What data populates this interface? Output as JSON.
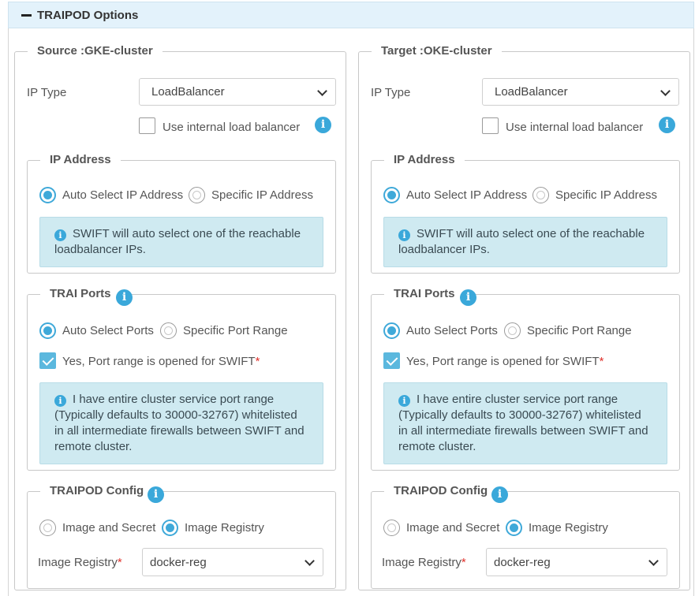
{
  "header": {
    "title": "TRAIPOD Options"
  },
  "panels": [
    {
      "legend": "Source :GKE-cluster",
      "ip_type_label": "IP Type",
      "ip_type_value": "LoadBalancer",
      "internal_lb_label": "Use internal load balancer",
      "ip_address": {
        "legend": "IP Address",
        "option_auto": "Auto Select IP Address",
        "option_specific": "Specific IP Address",
        "alert": "SWIFT will auto select one of the reachable loadbalancer IPs."
      },
      "trai_ports": {
        "legend": "TRAI Ports",
        "option_auto": "Auto Select Ports",
        "option_specific": "Specific Port Range",
        "checkbox_label": "Yes, Port range is opened for SWIFT",
        "required": "*",
        "alert": "I have entire cluster service port range (Typically defaults to 30000-32767) whitelisted in all intermediate firewalls between SWIFT and remote cluster."
      },
      "traipod_config": {
        "legend": "TRAIPOD Config",
        "option_image_secret": "Image and Secret",
        "option_image_registry": "Image Registry",
        "registry_label": "Image Registry",
        "required": "*",
        "registry_value": "docker-reg"
      }
    },
    {
      "legend": "Target :OKE-cluster",
      "ip_type_label": "IP Type",
      "ip_type_value": "LoadBalancer",
      "internal_lb_label": "Use internal load balancer",
      "ip_address": {
        "legend": "IP Address",
        "option_auto": "Auto Select IP Address",
        "option_specific": "Specific IP Address",
        "alert": "SWIFT will auto select one of the reachable loadbalancer IPs."
      },
      "trai_ports": {
        "legend": "TRAI Ports",
        "option_auto": "Auto Select Ports",
        "option_specific": "Specific Port Range",
        "checkbox_label": "Yes, Port range is opened for SWIFT",
        "required": "*",
        "alert": "I have entire cluster service port range (Typically defaults to 30000-32767) whitelisted in all intermediate firewalls between SWIFT and remote cluster."
      },
      "traipod_config": {
        "legend": "TRAIPOD Config",
        "option_image_secret": "Image and Secret",
        "option_image_registry": "Image Registry",
        "registry_label": "Image Registry",
        "required": "*",
        "registry_value": "docker-reg"
      }
    }
  ],
  "colors": {
    "accent": "#3aa8da",
    "alert_bg": "#cfeaf1",
    "header_bg": "#e3f2fb",
    "required": "#e0312b"
  },
  "icons": {
    "collapse": "minus-icon",
    "info": "info-icon",
    "dropdown": "chevron-down-icon"
  }
}
